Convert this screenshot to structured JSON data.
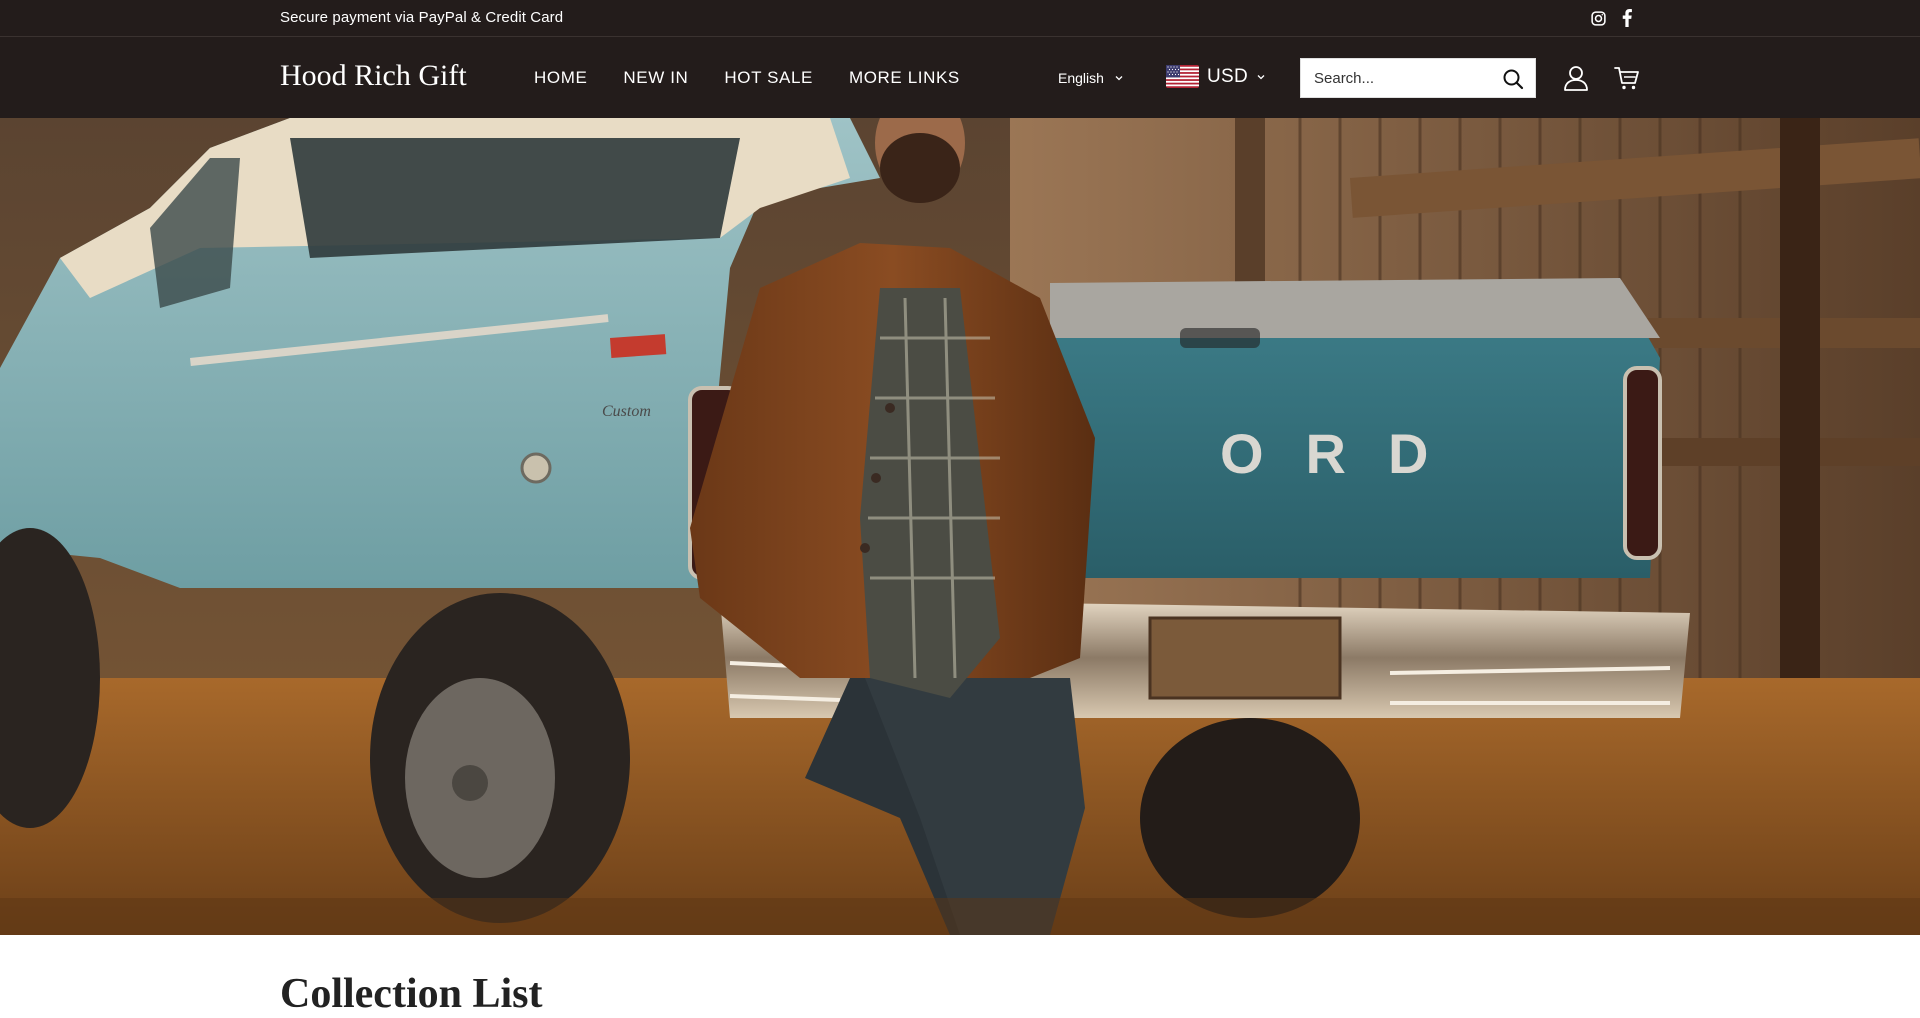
{
  "announcement": {
    "text": "Secure payment via PayPal & Credit Card",
    "social": [
      "instagram-icon",
      "facebook-icon"
    ]
  },
  "header": {
    "logo": "Hood Rich Gift",
    "nav": [
      "HOME",
      "NEW IN",
      "HOT SALE",
      "MORE LINKS"
    ],
    "language": "English",
    "currency": "USD",
    "search_placeholder": "Search...",
    "icons": [
      "search-icon",
      "account-icon",
      "cart-icon"
    ]
  },
  "hero": {
    "truck_lettering": "ORD",
    "truck_badge": "Custom"
  },
  "section": {
    "title": "Collection List"
  },
  "colors": {
    "header_bg": "#231c1b",
    "header_text": "#ffffff",
    "page_bg": "#ffffff"
  }
}
